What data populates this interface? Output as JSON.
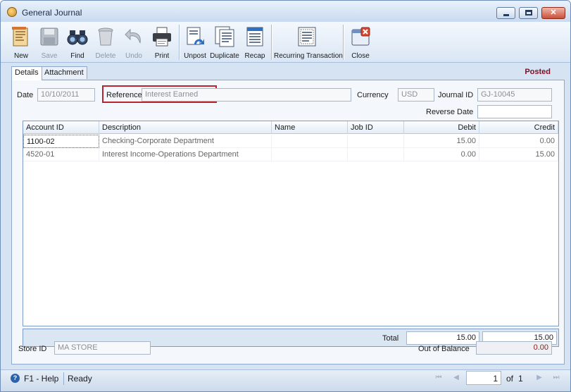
{
  "window": {
    "title": "General Journal"
  },
  "toolbar": {
    "buttons": [
      {
        "label": "New",
        "icon": "new-document-icon"
      },
      {
        "label": "Save",
        "icon": "save-disk-icon"
      },
      {
        "label": "Find",
        "icon": "binoculars-icon"
      },
      {
        "label": "Delete",
        "icon": "trash-icon"
      },
      {
        "label": "Undo",
        "icon": "undo-arrow-icon"
      },
      {
        "label": "Print",
        "icon": "printer-icon"
      },
      {
        "label": "Unpost",
        "icon": "unpost-icon"
      },
      {
        "label": "Duplicate",
        "icon": "duplicate-icon"
      },
      {
        "label": "Recap",
        "icon": "recap-icon"
      },
      {
        "label": "Recurring Transaction",
        "icon": "recurring-transaction-icon"
      },
      {
        "label": "Close",
        "icon": "close-icon"
      }
    ]
  },
  "tabs": [
    {
      "label": "Details"
    },
    {
      "label": "Attachment"
    }
  ],
  "status": "Posted",
  "form": {
    "date_label": "Date",
    "date_value": "10/10/2011",
    "reference_label": "Reference",
    "reference_value": "Interest Earned",
    "currency_label": "Currency",
    "currency_value": "USD",
    "journal_id_label": "Journal ID",
    "journal_id_value": "GJ-10045",
    "reverse_date_label": "Reverse Date",
    "reverse_date_value": ""
  },
  "grid": {
    "columns": [
      "Account ID",
      "Description",
      "Name",
      "Job ID",
      "Debit",
      "Credit"
    ],
    "rows": [
      {
        "account_id": "1100-02",
        "description": "Checking-Corporate Department",
        "name": "",
        "job_id": "",
        "debit": "15.00",
        "credit": "0.00"
      },
      {
        "account_id": "4520-01",
        "description": "Interest Income-Operations Department",
        "name": "",
        "job_id": "",
        "debit": "0.00",
        "credit": "15.00"
      }
    ]
  },
  "totals": {
    "label": "Total",
    "debit": "15.00",
    "credit": "15.00"
  },
  "footer": {
    "store_id_label": "Store ID",
    "store_id_value": "MA STORE",
    "out_of_balance_label": "Out of Balance",
    "out_of_balance_value": "0.00"
  },
  "statusbar": {
    "help": "F1 - Help",
    "state": "Ready",
    "page": "1",
    "of_label": "of",
    "total_pages": "1"
  },
  "colors": {
    "posted": "#7a1025",
    "reference_highlight": "#b8252f",
    "out_of_balance": "#8b1a1a"
  }
}
